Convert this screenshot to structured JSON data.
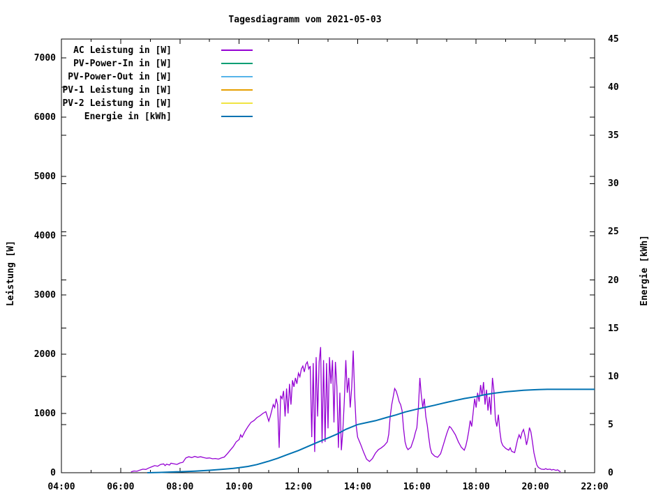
{
  "window": {
    "background": "#ffffff",
    "text_color": "#000000",
    "border_color": "#000000"
  },
  "chart_data": {
    "type": "line",
    "title": "Tagesdiagramm vom 2021-05-03",
    "grid": false,
    "legend_position": "top-left-inside",
    "x_axis": {
      "unit": "time_of_day",
      "range_hours": [
        4,
        22
      ],
      "major_tick_hours": [
        4,
        6,
        8,
        10,
        12,
        14,
        16,
        18,
        20,
        22
      ],
      "major_tick_labels": [
        "04:00",
        "06:00",
        "08:00",
        "10:00",
        "12:00",
        "14:00",
        "16:00",
        "18:00",
        "20:00",
        "22:00"
      ],
      "minor_tick_hours": [
        5,
        7,
        9,
        11,
        13,
        15,
        17,
        19,
        21
      ]
    },
    "y_axis_left": {
      "label": "Leistung [W]",
      "range": [
        0,
        7318
      ],
      "tick_values": [
        0,
        1000,
        2000,
        3000,
        4000,
        5000,
        6000,
        7000
      ]
    },
    "y_axis_right": {
      "label": "Energie [kWh]",
      "range": [
        0,
        45
      ],
      "tick_values": [
        0,
        5,
        10,
        15,
        20,
        25,
        30,
        35,
        40,
        45
      ]
    },
    "series": [
      {
        "name": "AC Leistung in [W]",
        "color": "#9400d3",
        "axis": "y1",
        "stroke_width": 1.3,
        "visible_in_plot": true,
        "points_hour_value": [
          [
            6.35,
            15
          ],
          [
            6.45,
            30
          ],
          [
            6.55,
            25
          ],
          [
            6.65,
            45
          ],
          [
            6.75,
            60
          ],
          [
            6.85,
            55
          ],
          [
            6.95,
            80
          ],
          [
            7.05,
            100
          ],
          [
            7.15,
            120
          ],
          [
            7.25,
            110
          ],
          [
            7.35,
            140
          ],
          [
            7.45,
            150
          ],
          [
            7.5,
            120
          ],
          [
            7.55,
            145
          ],
          [
            7.65,
            130
          ],
          [
            7.7,
            160
          ],
          [
            7.8,
            150
          ],
          [
            7.9,
            140
          ],
          [
            8.0,
            165
          ],
          [
            8.1,
            175
          ],
          [
            8.2,
            250
          ],
          [
            8.3,
            270
          ],
          [
            8.4,
            255
          ],
          [
            8.5,
            275
          ],
          [
            8.6,
            260
          ],
          [
            8.7,
            270
          ],
          [
            8.8,
            255
          ],
          [
            8.9,
            245
          ],
          [
            9.0,
            250
          ],
          [
            9.1,
            235
          ],
          [
            9.2,
            240
          ],
          [
            9.3,
            230
          ],
          [
            9.4,
            250
          ],
          [
            9.5,
            265
          ],
          [
            9.6,
            320
          ],
          [
            9.7,
            380
          ],
          [
            9.8,
            440
          ],
          [
            9.9,
            520
          ],
          [
            10.0,
            560
          ],
          [
            10.05,
            640
          ],
          [
            10.1,
            600
          ],
          [
            10.2,
            700
          ],
          [
            10.3,
            780
          ],
          [
            10.4,
            850
          ],
          [
            10.5,
            880
          ],
          [
            10.6,
            930
          ],
          [
            10.7,
            960
          ],
          [
            10.8,
            1000
          ],
          [
            10.9,
            1030
          ],
          [
            11.0,
            870
          ],
          [
            11.05,
            950
          ],
          [
            11.1,
            1050
          ],
          [
            11.15,
            1150
          ],
          [
            11.2,
            1100
          ],
          [
            11.25,
            1250
          ],
          [
            11.3,
            1150
          ],
          [
            11.35,
            420
          ],
          [
            11.4,
            1300
          ],
          [
            11.45,
            1250
          ],
          [
            11.5,
            1380
          ],
          [
            11.55,
            950
          ],
          [
            11.6,
            1420
          ],
          [
            11.65,
            1000
          ],
          [
            11.7,
            1500
          ],
          [
            11.75,
            1150
          ],
          [
            11.8,
            1560
          ],
          [
            11.85,
            1450
          ],
          [
            11.9,
            1600
          ],
          [
            11.95,
            1500
          ],
          [
            12.0,
            1680
          ],
          [
            12.05,
            1620
          ],
          [
            12.1,
            1750
          ],
          [
            12.15,
            1800
          ],
          [
            12.2,
            1700
          ],
          [
            12.25,
            1830
          ],
          [
            12.3,
            1870
          ],
          [
            12.35,
            1750
          ],
          [
            12.4,
            1800
          ],
          [
            12.45,
            600
          ],
          [
            12.5,
            1850
          ],
          [
            12.55,
            350
          ],
          [
            12.6,
            1950
          ],
          [
            12.65,
            950
          ],
          [
            12.7,
            1870
          ],
          [
            12.75,
            2120
          ],
          [
            12.8,
            500
          ],
          [
            12.85,
            1900
          ],
          [
            12.9,
            520
          ],
          [
            12.95,
            1850
          ],
          [
            13.0,
            750
          ],
          [
            13.05,
            1950
          ],
          [
            13.1,
            1500
          ],
          [
            13.15,
            1900
          ],
          [
            13.2,
            850
          ],
          [
            13.25,
            1870
          ],
          [
            13.3,
            1450
          ],
          [
            13.35,
            420
          ],
          [
            13.4,
            1350
          ],
          [
            13.45,
            380
          ],
          [
            13.5,
            700
          ],
          [
            13.55,
            1200
          ],
          [
            13.6,
            1900
          ],
          [
            13.65,
            1350
          ],
          [
            13.7,
            1600
          ],
          [
            13.75,
            1100
          ],
          [
            13.8,
            1450
          ],
          [
            13.85,
            2060
          ],
          [
            13.9,
            1300
          ],
          [
            13.95,
            800
          ],
          [
            14.0,
            600
          ],
          [
            14.1,
            480
          ],
          [
            14.2,
            350
          ],
          [
            14.3,
            230
          ],
          [
            14.4,
            190
          ],
          [
            14.5,
            240
          ],
          [
            14.6,
            330
          ],
          [
            14.7,
            390
          ],
          [
            14.8,
            420
          ],
          [
            14.9,
            460
          ],
          [
            15.0,
            520
          ],
          [
            15.05,
            650
          ],
          [
            15.1,
            950
          ],
          [
            15.15,
            1150
          ],
          [
            15.2,
            1280
          ],
          [
            15.25,
            1420
          ],
          [
            15.3,
            1380
          ],
          [
            15.35,
            1300
          ],
          [
            15.4,
            1200
          ],
          [
            15.45,
            1150
          ],
          [
            15.5,
            1050
          ],
          [
            15.55,
            750
          ],
          [
            15.6,
            520
          ],
          [
            15.65,
            430
          ],
          [
            15.7,
            390
          ],
          [
            15.8,
            430
          ],
          [
            15.9,
            580
          ],
          [
            15.95,
            680
          ],
          [
            16.0,
            760
          ],
          [
            16.05,
            1100
          ],
          [
            16.1,
            1600
          ],
          [
            16.15,
            1300
          ],
          [
            16.2,
            1100
          ],
          [
            16.25,
            1250
          ],
          [
            16.3,
            950
          ],
          [
            16.35,
            800
          ],
          [
            16.4,
            600
          ],
          [
            16.45,
            420
          ],
          [
            16.5,
            330
          ],
          [
            16.6,
            280
          ],
          [
            16.7,
            260
          ],
          [
            16.8,
            320
          ],
          [
            16.9,
            480
          ],
          [
            17.0,
            650
          ],
          [
            17.05,
            720
          ],
          [
            17.1,
            780
          ],
          [
            17.15,
            760
          ],
          [
            17.2,
            720
          ],
          [
            17.3,
            640
          ],
          [
            17.4,
            520
          ],
          [
            17.5,
            430
          ],
          [
            17.6,
            380
          ],
          [
            17.65,
            450
          ],
          [
            17.7,
            560
          ],
          [
            17.75,
            700
          ],
          [
            17.8,
            880
          ],
          [
            17.85,
            780
          ],
          [
            17.9,
            1020
          ],
          [
            17.95,
            1250
          ],
          [
            18.0,
            1100
          ],
          [
            18.05,
            1350
          ],
          [
            18.1,
            1200
          ],
          [
            18.15,
            1480
          ],
          [
            18.2,
            1300
          ],
          [
            18.25,
            1530
          ],
          [
            18.3,
            1150
          ],
          [
            18.35,
            1400
          ],
          [
            18.4,
            1050
          ],
          [
            18.45,
            1280
          ],
          [
            18.5,
            980
          ],
          [
            18.55,
            1600
          ],
          [
            18.6,
            1380
          ],
          [
            18.65,
            900
          ],
          [
            18.7,
            780
          ],
          [
            18.75,
            980
          ],
          [
            18.8,
            700
          ],
          [
            18.85,
            520
          ],
          [
            18.9,
            460
          ],
          [
            19.0,
            410
          ],
          [
            19.1,
            380
          ],
          [
            19.15,
            420
          ],
          [
            19.2,
            360
          ],
          [
            19.3,
            340
          ],
          [
            19.35,
            450
          ],
          [
            19.4,
            560
          ],
          [
            19.45,
            640
          ],
          [
            19.5,
            580
          ],
          [
            19.55,
            680
          ],
          [
            19.6,
            730
          ],
          [
            19.65,
            620
          ],
          [
            19.7,
            470
          ],
          [
            19.75,
            580
          ],
          [
            19.8,
            760
          ],
          [
            19.85,
            690
          ],
          [
            19.9,
            520
          ],
          [
            19.95,
            340
          ],
          [
            20.0,
            230
          ],
          [
            20.05,
            130
          ],
          [
            20.1,
            90
          ],
          [
            20.2,
            60
          ],
          [
            20.3,
            55
          ],
          [
            20.35,
            70
          ],
          [
            20.4,
            55
          ],
          [
            20.5,
            60
          ],
          [
            20.55,
            45
          ],
          [
            20.6,
            55
          ],
          [
            20.7,
            40
          ],
          [
            20.75,
            50
          ],
          [
            20.8,
            30
          ],
          [
            20.85,
            15
          ]
        ]
      },
      {
        "name": "PV-Power-In in [W]",
        "color": "#009e73",
        "axis": "y1",
        "stroke_width": 1.3,
        "visible_in_plot": false,
        "points_hour_value": []
      },
      {
        "name": "PV-Power-Out in [W]",
        "color": "#56b4e9",
        "axis": "y1",
        "stroke_width": 1.3,
        "visible_in_plot": false,
        "points_hour_value": []
      },
      {
        "name": "PV-1 Leistung in [W]",
        "color": "#e69f00",
        "axis": "y1",
        "stroke_width": 1.3,
        "visible_in_plot": false,
        "points_hour_value": []
      },
      {
        "name": "PV-2 Leistung in [W]",
        "color": "#f0e442",
        "axis": "y1",
        "stroke_width": 1.3,
        "visible_in_plot": false,
        "points_hour_value": []
      },
      {
        "name": "Energie in [kWh]",
        "color": "#0072b2",
        "axis": "y2",
        "stroke_width": 2,
        "visible_in_plot": true,
        "points_hour_value": [
          [
            6.9,
            0
          ],
          [
            7.3,
            0.03
          ],
          [
            7.7,
            0.07
          ],
          [
            8.0,
            0.1
          ],
          [
            8.5,
            0.17
          ],
          [
            9.0,
            0.25
          ],
          [
            9.5,
            0.37
          ],
          [
            9.8,
            0.45
          ],
          [
            10.0,
            0.52
          ],
          [
            10.3,
            0.65
          ],
          [
            10.6,
            0.85
          ],
          [
            11.0,
            1.2
          ],
          [
            11.3,
            1.5
          ],
          [
            11.6,
            1.85
          ],
          [
            12.0,
            2.3
          ],
          [
            12.3,
            2.7
          ],
          [
            12.6,
            3.1
          ],
          [
            13.0,
            3.6
          ],
          [
            13.3,
            4.0
          ],
          [
            13.6,
            4.5
          ],
          [
            14.0,
            5.0
          ],
          [
            14.3,
            5.2
          ],
          [
            14.6,
            5.4
          ],
          [
            15.0,
            5.75
          ],
          [
            15.3,
            6.0
          ],
          [
            15.6,
            6.3
          ],
          [
            16.0,
            6.6
          ],
          [
            16.3,
            6.8
          ],
          [
            16.6,
            7.0
          ],
          [
            17.0,
            7.3
          ],
          [
            17.3,
            7.5
          ],
          [
            17.6,
            7.7
          ],
          [
            18.0,
            7.9
          ],
          [
            18.3,
            8.1
          ],
          [
            18.6,
            8.25
          ],
          [
            19.0,
            8.4
          ],
          [
            19.3,
            8.47
          ],
          [
            19.6,
            8.55
          ],
          [
            19.9,
            8.6
          ],
          [
            20.1,
            8.63
          ],
          [
            20.4,
            8.65
          ],
          [
            22.0,
            8.65
          ]
        ]
      }
    ]
  }
}
